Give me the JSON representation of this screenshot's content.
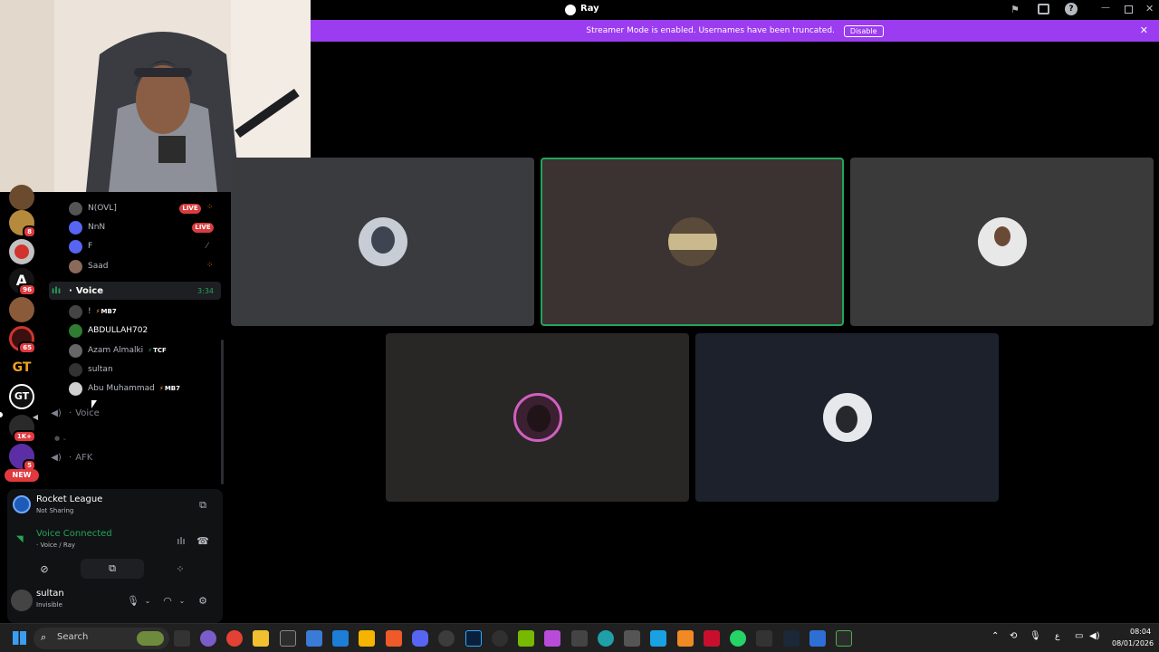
{
  "window": {
    "title": "Ray"
  },
  "banner": {
    "text": "Streamer Mode is enabled. Usernames have been truncated.",
    "disable_label": "Disable"
  },
  "servers": [
    {
      "badge": ""
    },
    {
      "badge": "8"
    },
    {
      "badge": ""
    },
    {
      "badge": "96"
    },
    {
      "badge": ""
    },
    {
      "badge": "65"
    },
    {
      "badge": ""
    },
    {
      "badge": ""
    },
    {
      "badge": "1K+"
    },
    {
      "badge": "5"
    }
  ],
  "server_labels": {
    "gt_text": "GT",
    "gt2_text": "GT",
    "new_label": "NEW"
  },
  "stream_members": [
    {
      "name": "N(OVL]",
      "live": "LIVE"
    },
    {
      "name": "NnN",
      "live": "LIVE"
    },
    {
      "name": "F",
      "live": ""
    },
    {
      "name": "Saad",
      "live": ""
    }
  ],
  "voice_channel": {
    "name": "Voice",
    "timer": "3:34"
  },
  "voice_members": [
    {
      "name": "!",
      "tag": "MB7"
    },
    {
      "name": "ABDULLAH702",
      "tag": ""
    },
    {
      "name": "Azam Almalki",
      "tag": "TCF"
    },
    {
      "name": "sultan",
      "tag": ""
    },
    {
      "name": "Abu Muhammad",
      "tag": "MB7"
    }
  ],
  "other_channels": [
    {
      "name": "Voice"
    },
    {
      "name": "AFK"
    }
  ],
  "activity": {
    "game": "Rocket League",
    "status": "Not Sharing"
  },
  "voice_status": {
    "title": "Voice Connected",
    "location": "Voice / Ray"
  },
  "user": {
    "name": "sultan",
    "status": "Invisible"
  },
  "taskbar": {
    "search_label": "Search",
    "time": "08:04",
    "date": "08/01/2026",
    "lang": "ع"
  },
  "colors": {
    "accent": "#9b3cf0",
    "green": "#23a55a",
    "live": "#d83c3e"
  }
}
